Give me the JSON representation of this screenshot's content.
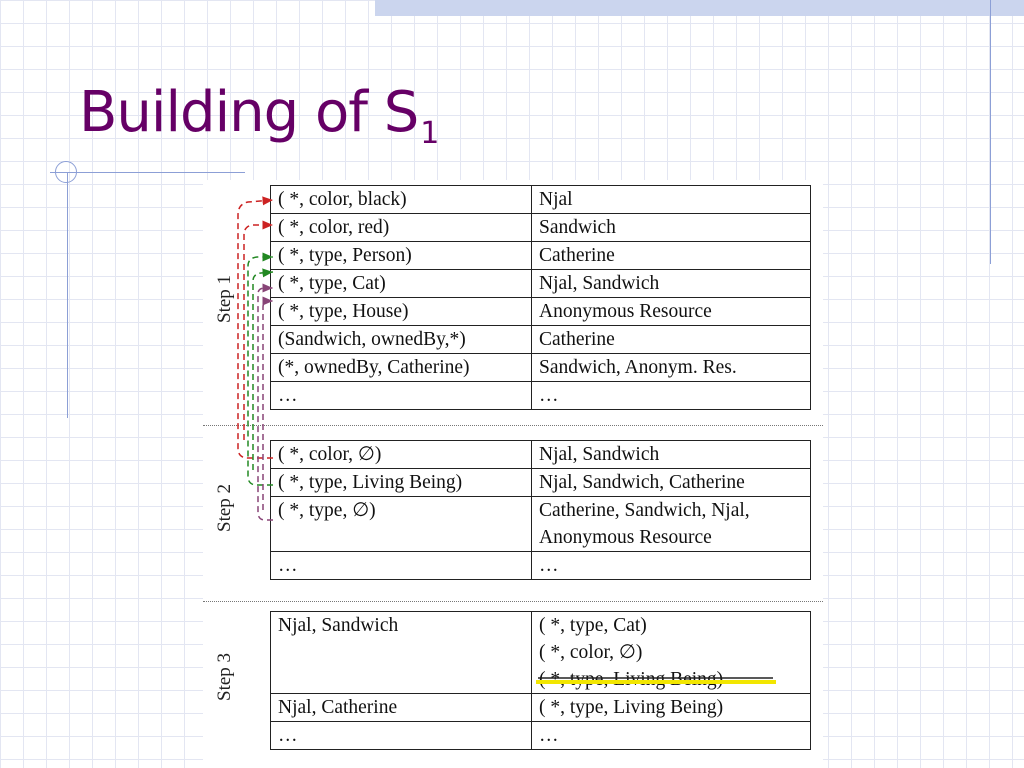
{
  "slide": {
    "title": "Building of S",
    "title_sub": "1"
  },
  "steps": {
    "step1": {
      "label": "Step 1",
      "rows": [
        [
          "( *, color, black)",
          "Njal"
        ],
        [
          "( *, color, red)",
          "Sandwich"
        ],
        [
          "( *, type, Person)",
          "Catherine"
        ],
        [
          "( *, type, Cat)",
          "Njal, Sandwich"
        ],
        [
          "( *, type, House)",
          "Anonymous Resource"
        ],
        [
          "(Sandwich, ownedBy,*)",
          "Catherine"
        ],
        [
          "(*, ownedBy, Catherine)",
          "Sandwich, Anonym. Res."
        ],
        [
          "…",
          "…"
        ]
      ]
    },
    "step2": {
      "label": "Step 2",
      "rows": [
        [
          " ( *, color, ∅)",
          "Njal, Sandwich"
        ],
        [
          " ( *, type, Living Being)",
          "Njal, Sandwich, Catherine"
        ],
        [
          " ( *, type, ∅)",
          "Catherine, Sandwich, Njal,",
          "Anonymous Resource"
        ],
        [
          "…",
          "…"
        ]
      ]
    },
    "step3": {
      "label": "Step 3",
      "rows": [
        [
          "Njal, Sandwich",
          "( *, type, Cat)",
          "( *, color, ∅)",
          "( *, type, Living Being)"
        ],
        [
          "Njal, Catherine",
          "( *, type, Living Being)"
        ],
        [
          "…",
          "…"
        ]
      ]
    }
  },
  "colors": {
    "title": "#660066",
    "arrow_red": "#cc2222",
    "arrow_green": "#228822",
    "arrow_purple": "#884477",
    "highlight": "#f2e600"
  }
}
